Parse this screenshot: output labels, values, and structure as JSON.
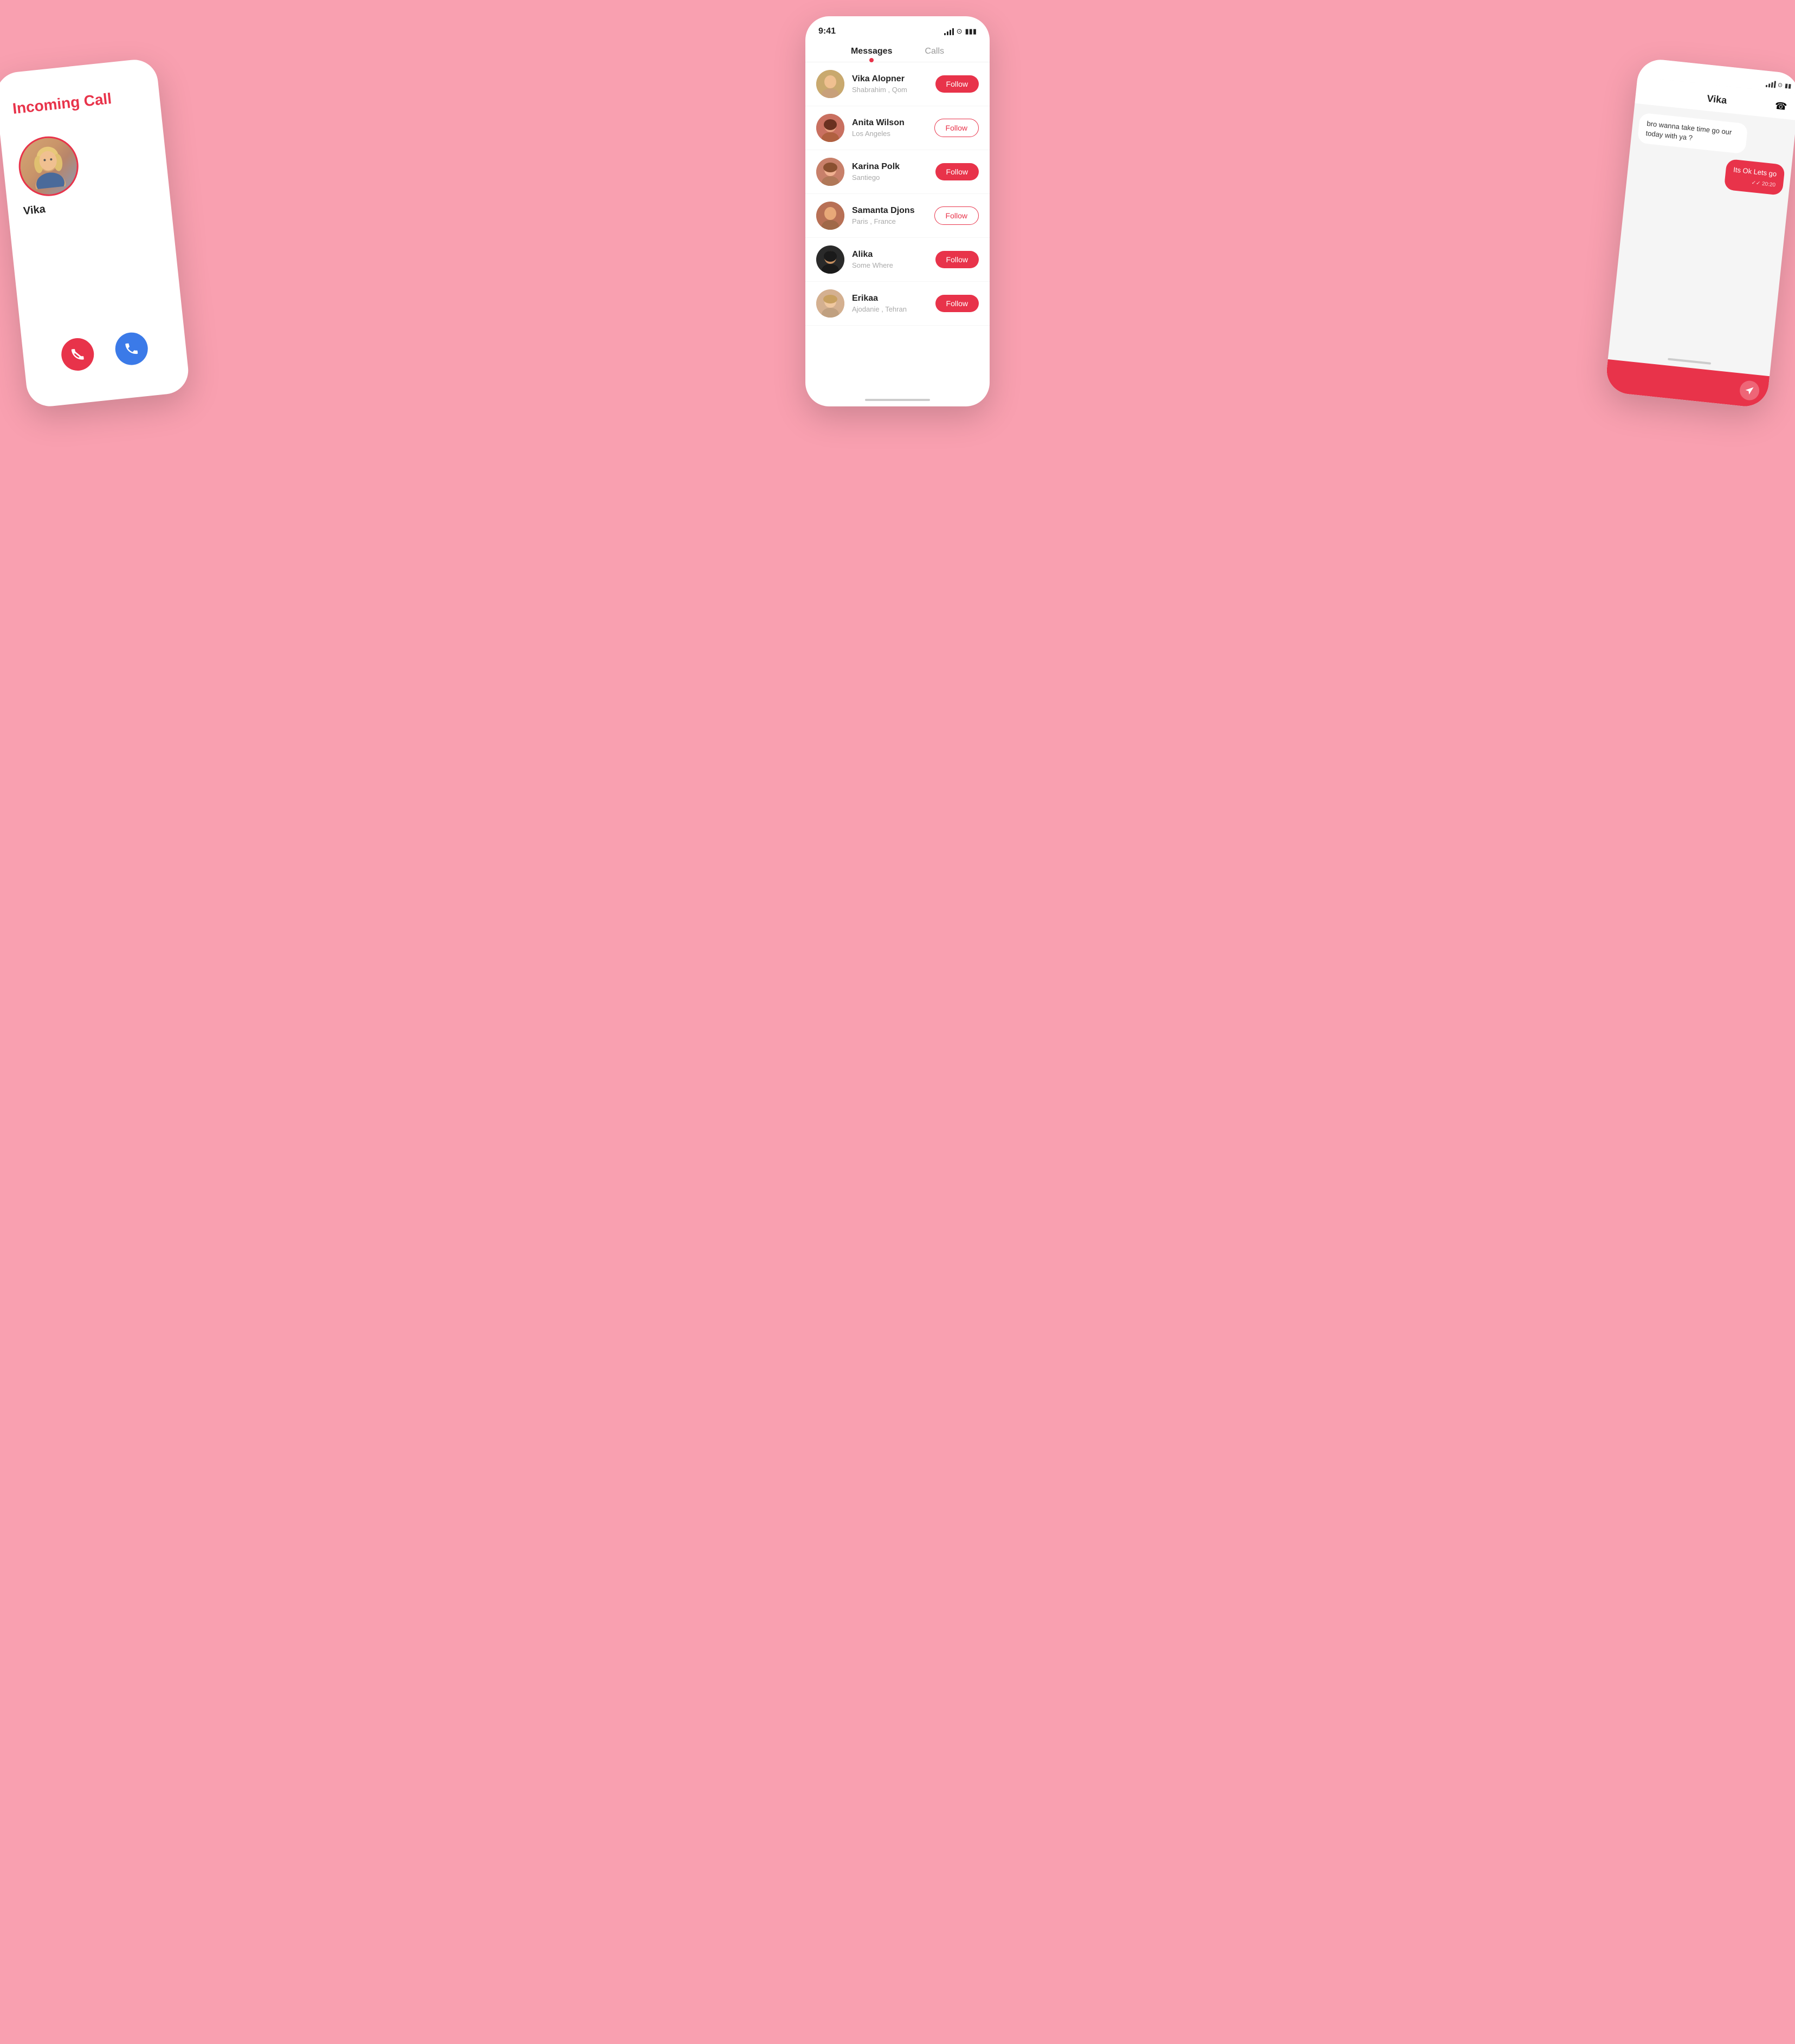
{
  "background_color": "#f9a0b0",
  "left_phone": {
    "title": "Incoming Call",
    "caller_name": "Vika",
    "decline_label": "decline",
    "accept_label": "accept"
  },
  "center_phone": {
    "status_bar": {
      "time": "9:41"
    },
    "tabs": [
      {
        "label": "Messages",
        "active": true
      },
      {
        "label": "Calls",
        "active": false
      }
    ],
    "contacts": [
      {
        "name": "Vika Alopner",
        "location": "Shabrahim , Qom",
        "follow_style": "filled"
      },
      {
        "name": "Anita Wilson",
        "location": "Los Angeles",
        "follow_style": "outline"
      },
      {
        "name": "Karina Polk",
        "location": "Santiego",
        "follow_style": "filled"
      },
      {
        "name": "Samanta Djons",
        "location": "Paris , France",
        "follow_style": "outline"
      },
      {
        "name": "Alika",
        "location": "Some Where",
        "follow_style": "filled"
      },
      {
        "name": "Erikaa",
        "location": "Ajodanie , Tehran",
        "follow_style": "filled"
      }
    ],
    "follow_label": "Follow"
  },
  "right_phone": {
    "header_name": "Vika",
    "messages": [
      {
        "text": "bro wanna take time go our today with ya ?",
        "type": "received"
      },
      {
        "text": "Its Ok Lets go",
        "type": "sent",
        "time": "20:20"
      }
    ]
  }
}
